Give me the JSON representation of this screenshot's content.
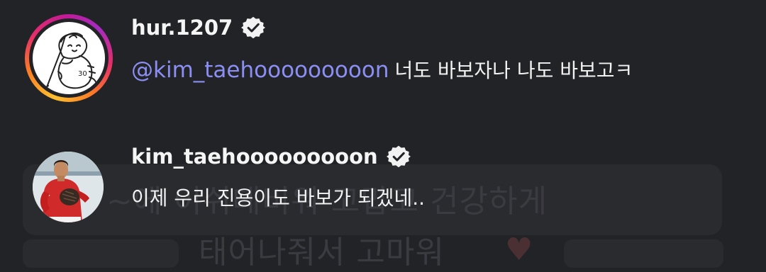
{
  "comments": [
    {
      "username": "hur.1207",
      "verified": true,
      "mention": "@kim_taehooooooooon",
      "text": "너도 바보자나 나도 바보고ㅋ",
      "avatar_icon": "cartoon-otter-baseball-icon",
      "has_story_ring": true
    },
    {
      "username": "kim_taehooooooooon",
      "verified": true,
      "text": "이제 우리 진용이도 바보가 되겠네..",
      "avatar_icon": "baseball-player-photo"
    }
  ],
  "background": {
    "ghost_line1": "~에 이쉬데비워 고맙고 건강하게",
    "ghost_line2": "태어나줘서 고마워"
  },
  "colors": {
    "background": "#222326",
    "mention": "#8b8ff4",
    "text": "#f2f2f2"
  }
}
